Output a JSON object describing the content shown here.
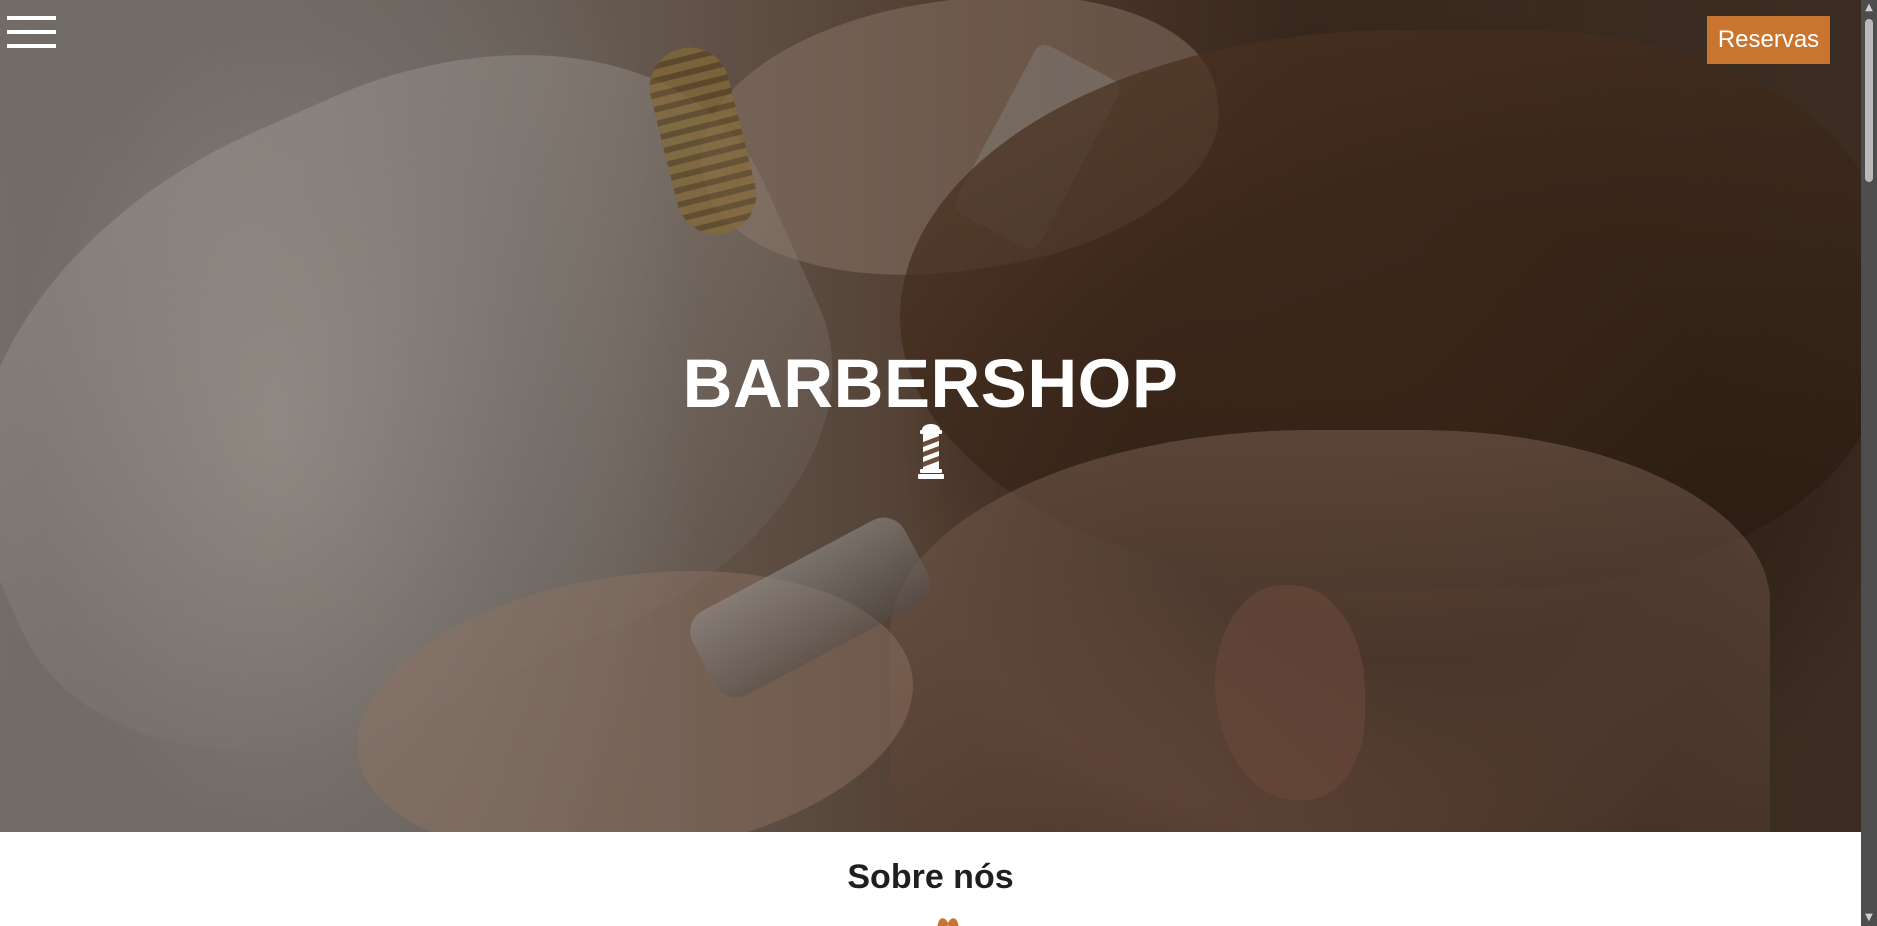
{
  "header": {
    "menu_icon": "hamburger-menu-icon",
    "reservation_label": "Reservas"
  },
  "hero": {
    "title": "BARBERSHOP",
    "icon": "barber-pole-icon"
  },
  "about": {
    "title": "Sobre nós",
    "icon": "mustache-icon"
  },
  "colors": {
    "accent": "#c9742f",
    "hero_text": "#ffffff",
    "section_text": "#1f1f1f",
    "scrollbar_track": "#4d4d4d",
    "scrollbar_thumb": "#b9b9b9"
  }
}
